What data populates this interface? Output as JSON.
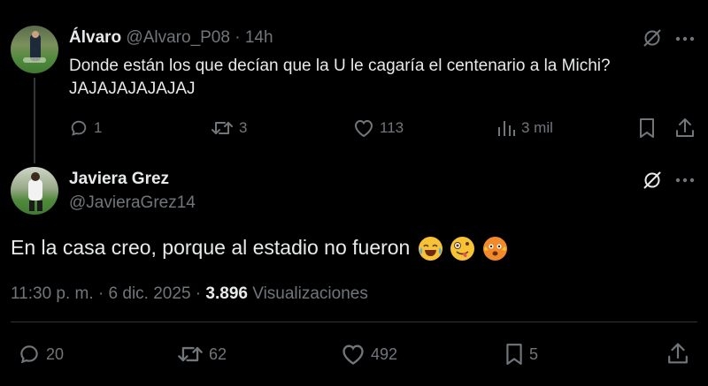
{
  "parent": {
    "name": "Álvaro",
    "handle": "@Alvaro_P08",
    "time": "14h",
    "text_line1": "Donde están los que decían que la U le cagaría el centenario a la Michi?",
    "text_line2": "JAJAJAJAJAJAJ",
    "replies": "1",
    "reposts": "3",
    "likes": "113",
    "views": "3 mil"
  },
  "main": {
    "name": "Javiera Grez",
    "handle": "@JavieraGrez14",
    "text": "En la casa creo, porque al estadio no fueron",
    "time": "11:30 p. m.",
    "date": "6 dic. 2025",
    "views_count": "3.896",
    "views_label": "Visualizaciones",
    "replies": "20",
    "reposts": "62",
    "likes": "492",
    "bookmarks": "5"
  },
  "colors": {
    "background": "#000000",
    "text": "#e7e9ea",
    "muted": "#71767b",
    "divider": "#2f3336"
  },
  "icons": [
    "grok-icon",
    "more-icon",
    "reply-icon",
    "repost-icon",
    "like-icon",
    "views-icon",
    "bookmark-icon",
    "share-icon"
  ]
}
